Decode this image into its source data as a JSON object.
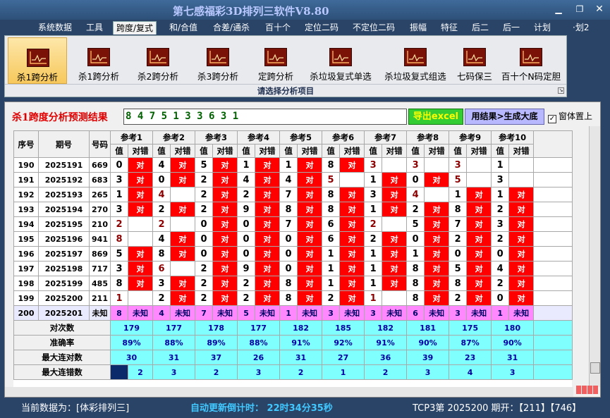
{
  "app": {
    "title": "第七感福彩3D排列三软件V8.80"
  },
  "menu": [
    "系统数据",
    "工具",
    "跨度/复式",
    "和/合值",
    "合差/通杀",
    "百十个",
    "定位二码",
    "不定位二码",
    "振幅",
    "特征",
    "后二",
    "后一",
    "计划",
    "·划2"
  ],
  "ribbon": {
    "items": [
      "杀1跨分析",
      "杀1跨分析",
      "杀2跨分析",
      "杀3跨分析",
      "定跨分析",
      "杀垃圾复式单选",
      "杀垃圾复式组选",
      "七码保三",
      "百十个N码定胆"
    ],
    "footer": "请选择分析项目"
  },
  "panel": {
    "title": "杀1跨度分析预测结果",
    "result": "8 4 7 5 1 3 3 6 3 1",
    "export_label": "导出excel",
    "generate_label": "用结果>生成大底",
    "ontop_label": "窗体置上"
  },
  "table": {
    "headers": {
      "seq": "序号",
      "period": "期号",
      "number": "号码",
      "val": "值",
      "check": "对错"
    },
    "refs": [
      "参考1",
      "参考2",
      "参考3",
      "参考4",
      "参考5",
      "参考6",
      "参考7",
      "参考8",
      "参考9",
      "参考10"
    ],
    "rows": [
      {
        "seq": "190",
        "period": "2025191",
        "num": "669",
        "vals": [
          "0",
          "4",
          "5",
          "1",
          "1",
          "8",
          "3",
          "3",
          "3",
          "1"
        ],
        "checks": [
          "对",
          "对",
          "对",
          "对",
          "对",
          "对",
          "",
          "",
          "",
          ""
        ],
        "big": [
          0,
          0,
          0,
          0,
          0,
          0,
          1,
          1,
          1,
          0
        ]
      },
      {
        "seq": "191",
        "period": "2025192",
        "num": "683",
        "vals": [
          "3",
          "0",
          "2",
          "4",
          "4",
          "5",
          "1",
          "0",
          "5",
          "3"
        ],
        "checks": [
          "对",
          "对",
          "对",
          "对",
          "对",
          "",
          "对",
          "对",
          "",
          ""
        ],
        "big": [
          0,
          0,
          0,
          0,
          0,
          1,
          0,
          0,
          1,
          0
        ]
      },
      {
        "seq": "192",
        "period": "2025193",
        "num": "265",
        "vals": [
          "1",
          "4",
          "2",
          "2",
          "7",
          "8",
          "3",
          "4",
          "1",
          "1"
        ],
        "checks": [
          "对",
          "",
          "对",
          "对",
          "对",
          "对",
          "对",
          "",
          "对",
          "对"
        ],
        "big": [
          0,
          1,
          0,
          0,
          0,
          0,
          0,
          1,
          0,
          0
        ]
      },
      {
        "seq": "193",
        "period": "2025194",
        "num": "270",
        "vals": [
          "3",
          "2",
          "2",
          "9",
          "8",
          "8",
          "1",
          "2",
          "8",
          "2"
        ],
        "checks": [
          "对",
          "对",
          "对",
          "对",
          "对",
          "对",
          "对",
          "对",
          "对",
          "对"
        ],
        "big": [
          0,
          0,
          0,
          0,
          0,
          0,
          0,
          0,
          0,
          0
        ]
      },
      {
        "seq": "194",
        "period": "2025195",
        "num": "210",
        "vals": [
          "2",
          "2",
          "0",
          "0",
          "7",
          "6",
          "2",
          "5",
          "7",
          "3"
        ],
        "checks": [
          "",
          "",
          "对",
          "对",
          "对",
          "对",
          "",
          "对",
          "对",
          "对"
        ],
        "big": [
          1,
          1,
          0,
          0,
          0,
          0,
          1,
          0,
          0,
          0
        ]
      },
      {
        "seq": "195",
        "period": "2025196",
        "num": "941",
        "vals": [
          "8",
          "4",
          "0",
          "0",
          "0",
          "6",
          "2",
          "0",
          "2",
          "2"
        ],
        "checks": [
          "",
          "对",
          "对",
          "对",
          "对",
          "对",
          "对",
          "对",
          "对",
          "对"
        ],
        "big": [
          1,
          0,
          0,
          0,
          0,
          0,
          0,
          0,
          0,
          0
        ]
      },
      {
        "seq": "196",
        "period": "2025197",
        "num": "869",
        "vals": [
          "5",
          "8",
          "0",
          "0",
          "0",
          "1",
          "1",
          "1",
          "0",
          "0"
        ],
        "checks": [
          "对",
          "对",
          "对",
          "对",
          "对",
          "对",
          "对",
          "对",
          "对",
          "对"
        ],
        "big": [
          0,
          0,
          0,
          0,
          0,
          0,
          0,
          0,
          0,
          0
        ]
      },
      {
        "seq": "197",
        "period": "2025198",
        "num": "717",
        "vals": [
          "3",
          "6",
          "2",
          "9",
          "0",
          "1",
          "1",
          "8",
          "5",
          "4"
        ],
        "checks": [
          "对",
          "",
          "对",
          "对",
          "对",
          "对",
          "对",
          "对",
          "对",
          "对"
        ],
        "big": [
          0,
          1,
          0,
          0,
          0,
          0,
          0,
          0,
          0,
          0
        ]
      },
      {
        "seq": "198",
        "period": "2025199",
        "num": "485",
        "vals": [
          "8",
          "3",
          "2",
          "2",
          "8",
          "1",
          "1",
          "8",
          "8",
          "2"
        ],
        "checks": [
          "对",
          "对",
          "对",
          "对",
          "对",
          "对",
          "对",
          "对",
          "对",
          "对"
        ],
        "big": [
          0,
          0,
          0,
          0,
          0,
          0,
          0,
          0,
          0,
          0
        ]
      },
      {
        "seq": "199",
        "period": "2025200",
        "num": "211",
        "vals": [
          "1",
          "2",
          "2",
          "2",
          "8",
          "2",
          "1",
          "8",
          "2",
          "0"
        ],
        "checks": [
          "",
          "对",
          "对",
          "对",
          "对",
          "对",
          "",
          "对",
          "对",
          "对"
        ],
        "big": [
          1,
          0,
          0,
          0,
          0,
          0,
          1,
          0,
          0,
          0
        ]
      }
    ],
    "prediction": {
      "seq": "200",
      "period": "2025201",
      "num": "未知",
      "vals": [
        "8",
        "4",
        "7",
        "5",
        "1",
        "3",
        "3",
        "6",
        "3",
        "1"
      ],
      "check": "未知"
    },
    "stats": [
      {
        "label": "对次数",
        "values": [
          "179",
          "177",
          "178",
          "177",
          "182",
          "185",
          "182",
          "181",
          "175",
          "180"
        ]
      },
      {
        "label": "准确率",
        "values": [
          "89%",
          "88%",
          "89%",
          "88%",
          "91%",
          "92%",
          "91%",
          "90%",
          "87%",
          "90%"
        ]
      },
      {
        "label": "最大连对数",
        "values": [
          "30",
          "31",
          "37",
          "26",
          "31",
          "27",
          "36",
          "39",
          "23",
          "31"
        ]
      },
      {
        "label": "最大连错数",
        "values": [
          "2",
          "3",
          "2",
          "3",
          "2",
          "1",
          "2",
          "3",
          "4",
          "3"
        ]
      }
    ]
  },
  "status": {
    "data_label": "当前数据为：[体彩排列三]",
    "countdown": "自动更新倒计时：  22时34分35秒",
    "draw": "TCP3第 2025200 期开：【211】【746】"
  },
  "colors": {
    "hit": "#ff0000",
    "prediction": "#ff88ff",
    "stats": "#80ffff",
    "title": "#e00000"
  }
}
